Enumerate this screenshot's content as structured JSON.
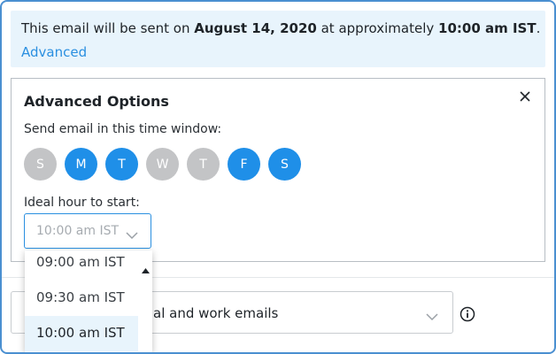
{
  "schedule_notice": {
    "prefix": "This email will be sent on ",
    "date": "August 14, 2020",
    "middle": " at approximately ",
    "time": "10:00 am IST",
    "suffix": ".",
    "advanced_link": "Advanced"
  },
  "advanced_options": {
    "title": "Advanced Options",
    "time_window_label": "Send email in this time window:",
    "days": [
      {
        "label": "S",
        "selected": false
      },
      {
        "label": "M",
        "selected": true
      },
      {
        "label": "T",
        "selected": true
      },
      {
        "label": "W",
        "selected": false
      },
      {
        "label": "T",
        "selected": false
      },
      {
        "label": "F",
        "selected": true
      },
      {
        "label": "S",
        "selected": true
      }
    ],
    "ideal_hour_label": "Ideal hour to start:",
    "ideal_hour_value": "10:00 am IST"
  },
  "hour_dropdown": {
    "options": [
      "09:00 am IST",
      "09:30 am IST",
      "10:00 am IST"
    ],
    "selected": "10:00 am IST"
  },
  "email_type_select": {
    "visible_text": "al and work emails"
  },
  "colors": {
    "accent": "#1f8fe8",
    "day_off": "#c3c4c6",
    "info_bg": "#e8f4fc",
    "link": "#2a8fe0"
  }
}
